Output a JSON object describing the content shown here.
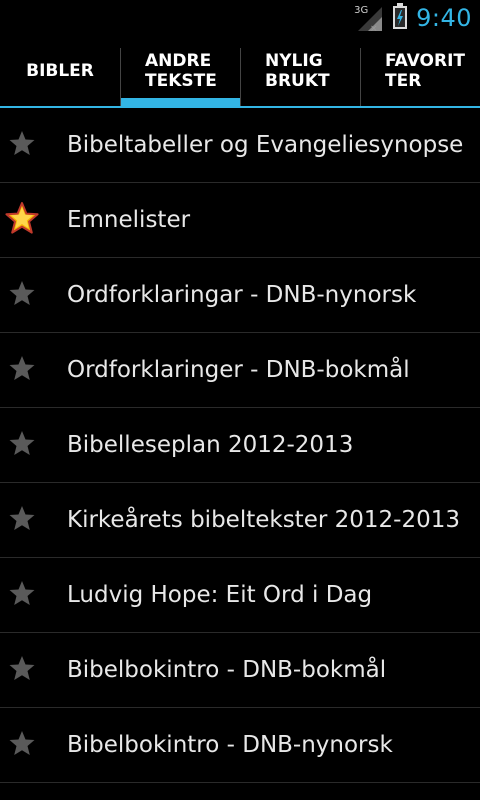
{
  "status_bar": {
    "network_type": "3G",
    "time": "9:40",
    "icons": [
      "signal-icon",
      "battery-charging-icon"
    ]
  },
  "tabs": [
    {
      "label": "BIBLER",
      "selected": false
    },
    {
      "label": "ANDRE\nTEKSTE",
      "selected": true
    },
    {
      "label": "NYLIG\nBRUKT",
      "selected": false
    },
    {
      "label": "FAVORIT\nTER",
      "selected": false
    }
  ],
  "list": {
    "items": [
      {
        "label": "Bibeltabeller og Evangeliesynopse",
        "favorite": false
      },
      {
        "label": "Emnelister",
        "favorite": true
      },
      {
        "label": "Ordforklaringar - DNB-nynorsk",
        "favorite": false
      },
      {
        "label": "Ordforklaringer - DNB-bokmål",
        "favorite": false
      },
      {
        "label": "Bibelleseplan 2012-2013",
        "favorite": false
      },
      {
        "label": "Kirkeårets bibeltekster 2012-2013",
        "favorite": false
      },
      {
        "label": "Ludvig Hope: Eit Ord i Dag",
        "favorite": false
      },
      {
        "label": "Bibelbokintro - DNB-bokmål",
        "favorite": false
      },
      {
        "label": "Bibelbokintro - DNB-nynorsk",
        "favorite": false
      }
    ]
  },
  "colors": {
    "accent": "#33b5e5",
    "star_inactive": "#5a5a5a",
    "star_active": "#f5b800",
    "background": "#000000"
  }
}
